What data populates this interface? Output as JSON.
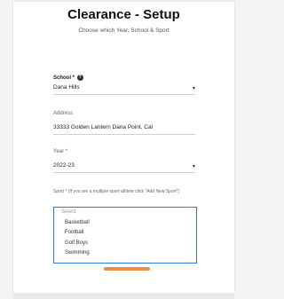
{
  "header": {
    "title": "Clearance - Setup",
    "subtitle": "Choose which Year, School & Sport"
  },
  "school": {
    "label": "School *",
    "value": "Dana Hills"
  },
  "address": {
    "label": "Address",
    "value": "33333 Golden Lantern Dana Point, Cal"
  },
  "year": {
    "label": "Year *",
    "value": "2022-23"
  },
  "sport": {
    "label": "Sport * (If you are a multiple sport athlete click \"Add New Sport\")",
    "options": [
      "Select",
      "Basketball",
      "Football",
      "Golf Boys",
      "Swimming"
    ]
  }
}
